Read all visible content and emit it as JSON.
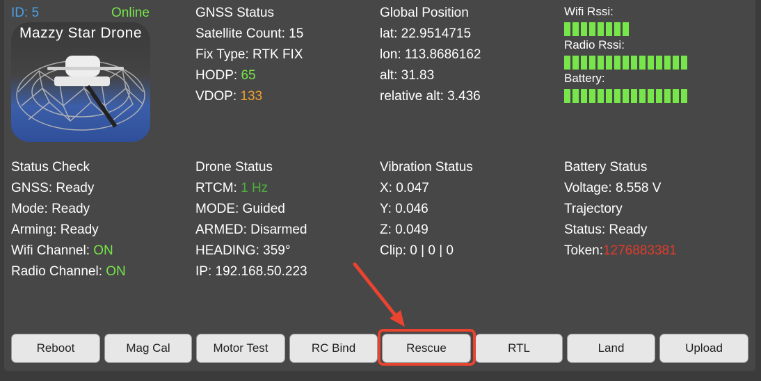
{
  "header": {
    "id_label": "ID: 5",
    "status": "Online"
  },
  "thumbnail": {
    "brand_text": "Mazzy Star Drone"
  },
  "gnss": {
    "title": "GNSS Status",
    "satellite": "Satellite Count: 15",
    "fix": "Fix Type: RTK FIX",
    "hdop_label": "HODP: ",
    "hdop_value": "65",
    "vdop_label": "VDOP: ",
    "vdop_value": "133"
  },
  "global_position": {
    "title": "Global Position",
    "lat": "lat: 22.9514715",
    "lon": "lon: 113.8686162",
    "alt": "alt: 31.83",
    "rel_alt": "relative alt: 3.436"
  },
  "signals": {
    "wifi_label": "Wifi Rssi:",
    "wifi_level": 8,
    "radio_label": "Radio Rssi:",
    "radio_level": 15,
    "battery_label": "Battery:",
    "battery_level": 15,
    "bar_color": "#77e64a"
  },
  "status_check": {
    "title": "Status Check",
    "gnss": "GNSS: Ready",
    "mode": "Mode: Ready",
    "arming": "Arming: Ready",
    "wifi_label": "Wifi Channel: ",
    "wifi_value": "ON",
    "radio_label": "Radio Channel: ",
    "radio_value": "ON"
  },
  "drone_status": {
    "title": "Drone Status",
    "rtcm_label": "RTCM: ",
    "rtcm_value": "1 Hz",
    "mode": "MODE: Guided",
    "armed": "ARMED: Disarmed",
    "heading": "HEADING: 359°",
    "ip": "IP: 192.168.50.223"
  },
  "vibration": {
    "title": "Vibration Status",
    "x": "X: 0.047",
    "y": "Y: 0.046",
    "z": "Z: 0.049",
    "clip": "Clip: 0 | 0 | 0"
  },
  "battery": {
    "title": "Battery Status",
    "voltage": "Voltage: 8.558 V",
    "trajectory": "Trajectory",
    "status": "Status: Ready",
    "token_label": "Token:",
    "token_value": "1276883381"
  },
  "buttons": [
    "Reboot",
    "Mag Cal",
    "Motor Test",
    "RC Bind",
    "Rescue",
    "RTL",
    "Land",
    "Upload"
  ],
  "colors": {
    "accent_blue": "#4a9fe6",
    "green": "#77e64a",
    "orange": "#f0a030",
    "dark_green": "#4caf3a",
    "red": "#e03c2c",
    "highlight": "#e9442f"
  }
}
